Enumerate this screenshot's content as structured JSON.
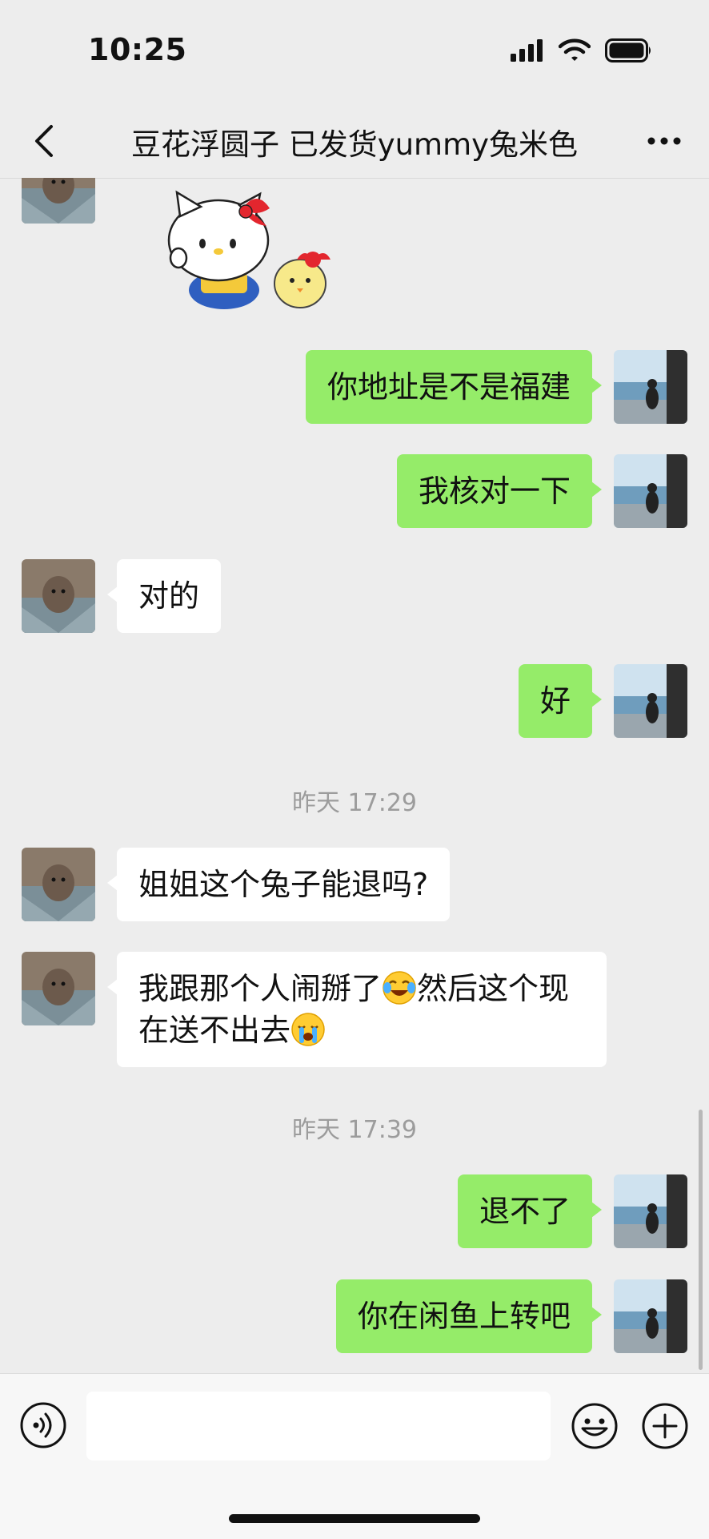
{
  "status_bar": {
    "time": "10:25"
  },
  "header": {
    "title": "豆花浮圆子 已发货yummy兔米色"
  },
  "messages": {
    "m1": "你地址是不是福建",
    "m2": "我核对一下",
    "m3": "对的",
    "m4": "好",
    "ts1": "昨天 17:29",
    "m5": "姐姐这个兔子能退吗?",
    "m6_part1": "我跟那个人闹掰了",
    "m6_part2": "然后这个现",
    "m6_part3": "在送不出去",
    "ts2": "昨天 17:39",
    "m7": "退不了",
    "m8": "你在闲鱼上转吧"
  },
  "icons": {
    "sticker": "hello-kitty-sticker",
    "emoji_1": "tearful-laughing-emoji",
    "emoji_2": "crying-emoji"
  },
  "input": {
    "value": ""
  },
  "colors": {
    "my_bubble": "#95ec69",
    "other_bubble": "#ffffff",
    "background": "#ededed"
  }
}
